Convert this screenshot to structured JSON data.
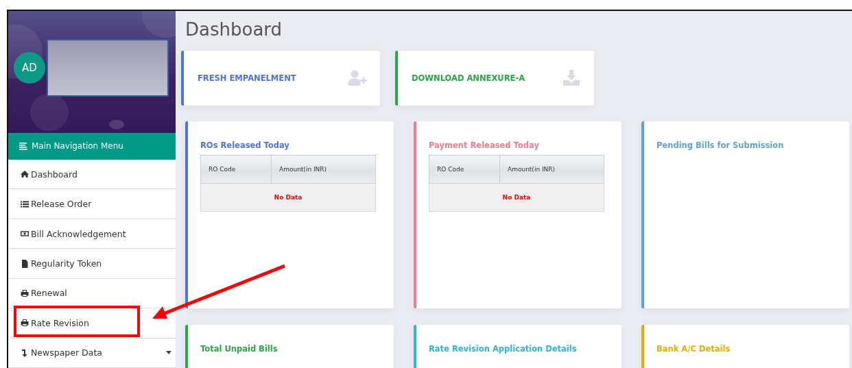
{
  "profile": {
    "initials": "AD"
  },
  "nav": {
    "title": "Main Navigation Menu",
    "items": [
      {
        "label": "Dashboard",
        "kind": "home",
        "has_submenu": false,
        "highlighted": false
      },
      {
        "label": "Release Order",
        "kind": "list",
        "has_submenu": false,
        "highlighted": false
      },
      {
        "label": "Bill Acknowledgement",
        "kind": "money",
        "has_submenu": false,
        "highlighted": false
      },
      {
        "label": "Regularity Token",
        "kind": "file",
        "has_submenu": false,
        "highlighted": false
      },
      {
        "label": "Renewal",
        "kind": "print",
        "has_submenu": false,
        "highlighted": false
      },
      {
        "label": "Rate Revision",
        "kind": "print",
        "has_submenu": false,
        "highlighted": true
      },
      {
        "label": "Newspaper Data",
        "kind": "sort",
        "has_submenu": true,
        "highlighted": false
      }
    ]
  },
  "page_title": "Dashboard",
  "action_cards": [
    {
      "label": "FRESH EMPANELMENT",
      "kind": "user",
      "color": "#4e73df"
    },
    {
      "label": "DOWNLOAD ANNEXURE-A",
      "kind": "download",
      "color": "#28a745"
    }
  ],
  "panels": [
    {
      "title": "ROs Released Today",
      "color": "#4e73df",
      "kind": "table",
      "columns": [
        "RO Code",
        "Amount(in INR)"
      ],
      "empty": "No Data"
    },
    {
      "title": "Payment Released Today",
      "color": "#f47c8a",
      "kind": "table",
      "columns": [
        "RO Code",
        "Amount(in INR)"
      ],
      "empty": "No Data"
    },
    {
      "title": "Pending Bills for Submission",
      "color": "#5fa2d0",
      "kind": "blank"
    },
    {
      "title": "Total Unpaid Bills",
      "color": "#28a745",
      "kind": "blank"
    },
    {
      "title": "Rate Revision Application Details",
      "color": "#2bb6cf",
      "kind": "blank"
    },
    {
      "title": "Bank A/C Details",
      "color": "#e6ac00",
      "kind": "blank"
    }
  ]
}
